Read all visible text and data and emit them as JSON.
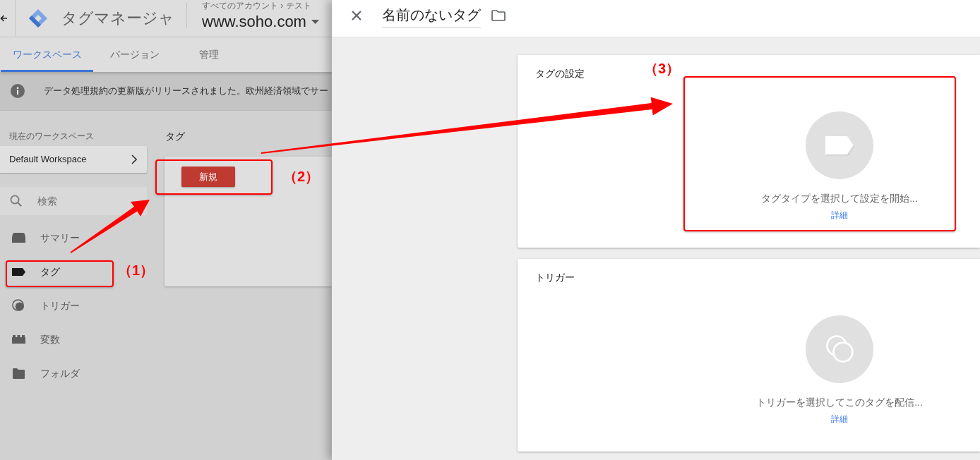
{
  "gtm_header": {
    "product": "タグマネージャ",
    "breadcrumb": "すべてのアカウント › テスト",
    "container": "www.soho.com"
  },
  "tabs": [
    {
      "label": "ワークスペース",
      "selected": true
    },
    {
      "label": "バージョン",
      "selected": false
    },
    {
      "label": "管理",
      "selected": false
    }
  ],
  "notice": {
    "text": "データ処理規約の更新版がリリースされました。欧州経済領域でサー"
  },
  "workspace": {
    "heading": "現在のワークスペース",
    "name": "Default Workspace"
  },
  "search": {
    "placeholder": "検索"
  },
  "sidebar": {
    "items": [
      {
        "label": "サマリー",
        "kind": "summary",
        "selected": false
      },
      {
        "label": "タグ",
        "kind": "tag",
        "selected": true
      },
      {
        "label": "トリガー",
        "kind": "trigger",
        "selected": false
      },
      {
        "label": "変数",
        "kind": "variable",
        "selected": false
      },
      {
        "label": "フォルダ",
        "kind": "folder",
        "selected": false
      }
    ]
  },
  "tags_section": {
    "heading": "タグ",
    "new_button": "新規"
  },
  "tag_editor": {
    "title": "名前のないタグ",
    "sections": [
      {
        "kind": "tag",
        "heading": "タグの設定",
        "prompt": "タグタイプを選択して設定を開始...",
        "link": "詳細"
      },
      {
        "kind": "trigger",
        "heading": "トリガー",
        "prompt": "トリガーを選択してこのタグを配信...",
        "link": "詳細"
      }
    ]
  },
  "annotations": [
    {
      "label": "（1）"
    },
    {
      "label": "（2）"
    },
    {
      "label": "（3）"
    }
  ]
}
